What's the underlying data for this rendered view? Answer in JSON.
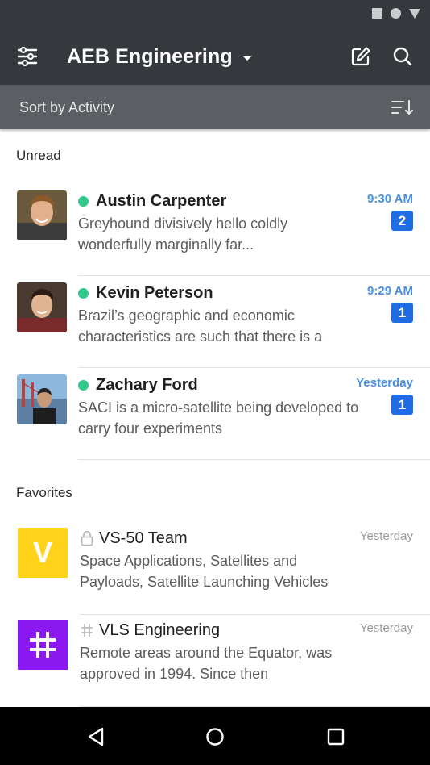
{
  "app": {
    "title": "AEB Engineering",
    "sort_label": "Sort by Activity"
  },
  "sections": {
    "unread": "Unread",
    "favorites": "Favorites"
  },
  "unread": [
    {
      "name": "Austin Carpenter",
      "time": "9:30 AM",
      "badge": "2",
      "preview": "Greyhound divisively hello coldly wonderfully marginally far..."
    },
    {
      "name": "Kevin Peterson",
      "time": "9:29 AM",
      "badge": "1",
      "preview": "Brazil’s geographic and economic characteristics are such that there is a"
    },
    {
      "name": "Zachary Ford",
      "time": "Yesterday",
      "badge": "1",
      "preview": "SACI is a micro-satellite being developed to carry four experiments"
    }
  ],
  "favorites": [
    {
      "tile_letter": "V",
      "name": "VS-50 Team",
      "time": "Yesterday",
      "preview": "Space Applications, Satellites and Payloads, Satellite Launching Vehicles",
      "icon": "lock-icon",
      "tile_color": "#ffd31a"
    },
    {
      "tile_letter": "#",
      "name": "VLS Engineering",
      "time": "Yesterday",
      "preview": "Remote areas around the Equator, was approved in 1994. Since then",
      "icon": "hash-icon",
      "tile_color": "#8b18f0"
    }
  ],
  "colors": {
    "header": "#35383d",
    "sortbar": "#5b5e63",
    "accent": "#4a90e2",
    "badge": "#1f6de5",
    "online": "#34c98c"
  }
}
